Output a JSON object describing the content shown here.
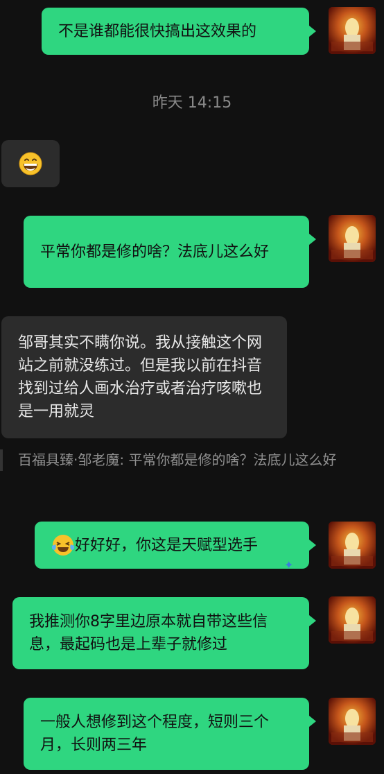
{
  "chat": {
    "timestamp": "昨天 14:15",
    "messages": [
      {
        "id": "m1",
        "side": "out",
        "text": "不是谁都能很快搞出这效果的"
      },
      {
        "id": "m2",
        "side": "in",
        "emoji": "grinning-face"
      },
      {
        "id": "m3",
        "side": "out",
        "text": "平常你都是修的啥？法底儿这么好"
      },
      {
        "id": "m4",
        "side": "in",
        "text": "邹哥其实不瞒你说。我从接触这个网站之前就没练过。但是我以前在抖音找到过给人画水治疗或者治疗咳嗽也是一用就灵"
      },
      {
        "id": "m5",
        "side": "out",
        "emoji": "laughing-tears",
        "text": "好好好，你这是天赋型选手"
      },
      {
        "id": "m6",
        "side": "out",
        "text": "我推测你8字里边原本就自带这些信息，最起码也是上辈子就修过"
      },
      {
        "id": "m7",
        "side": "out",
        "text": "一般人想修到这个程度，短则三个月，长则两三年"
      }
    ],
    "quote": {
      "text": "百福具臻·邹老魔: 平常你都是修的啥？法底儿这么好"
    }
  },
  "colors": {
    "background": "#111111",
    "outgoing_bubble": "#2fd680",
    "incoming_bubble": "#2c2c2c",
    "timestamp": "#8a8a8a",
    "quote_text": "#8f8f8f"
  }
}
